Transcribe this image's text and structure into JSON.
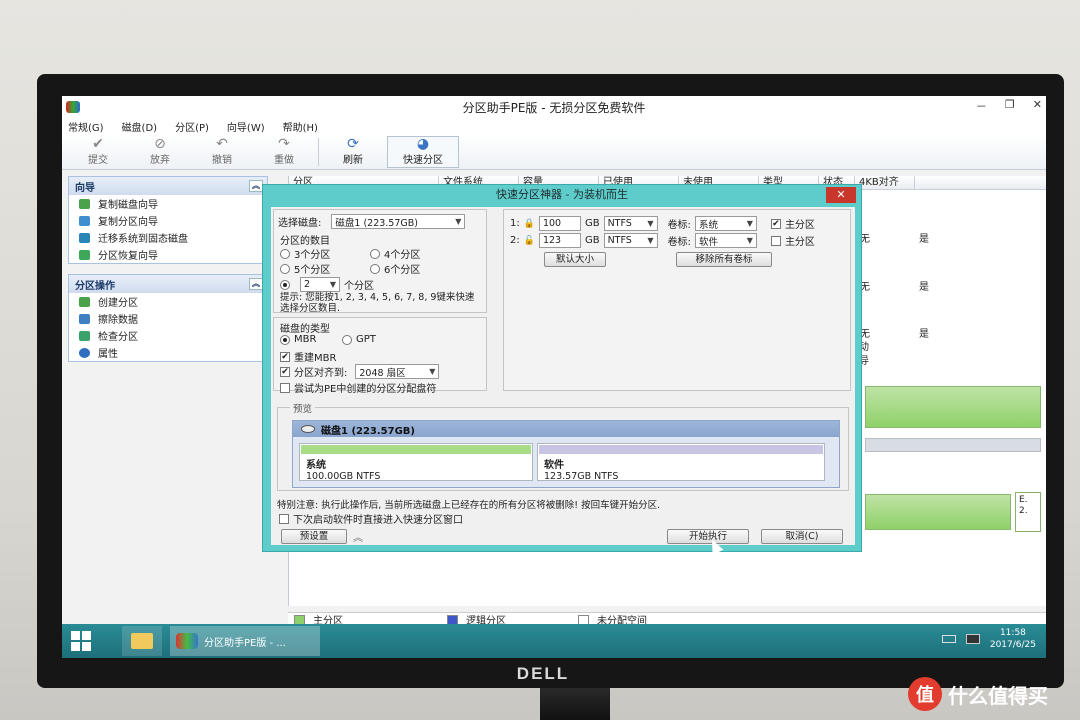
{
  "window": {
    "title": "分区助手PE版 - 无损分区免费软件",
    "controls": [
      "－",
      "❐",
      "✕"
    ]
  },
  "menu": [
    "常规(G)",
    "磁盘(D)",
    "分区(P)",
    "向导(W)",
    "帮助(H)"
  ],
  "toolbar": [
    {
      "label": "提交",
      "icon": "check-icon"
    },
    {
      "label": "放弃",
      "icon": "discard-icon"
    },
    {
      "label": "撤销",
      "icon": "undo-icon"
    },
    {
      "label": "重做",
      "icon": "redo-icon"
    },
    {
      "label": "刷新",
      "icon": "refresh-icon"
    },
    {
      "label": "快速分区",
      "icon": "quick-partition-icon"
    }
  ],
  "sidebar": {
    "wizard": {
      "title": "向导",
      "items": [
        "复制磁盘向导",
        "复制分区向导",
        "迁移系统到固态磁盘",
        "分区恢复向导"
      ]
    },
    "partition_ops": {
      "title": "分区操作",
      "items": [
        "创建分区",
        "擦除数据",
        "检查分区",
        "属性"
      ]
    }
  },
  "table": {
    "headers": [
      "分区",
      "文件系统",
      "容量",
      "已使用",
      "未使用",
      "类型",
      "状态",
      "4KB对齐"
    ],
    "visible_cells": [
      "无",
      "是",
      "无",
      "是",
      "无",
      "是",
      "活动",
      "引导"
    ]
  },
  "status_legend": [
    "主分区",
    "逻辑分区",
    "未分配空间"
  ],
  "disk_map_snippet": "E.\n2.",
  "taskbar": {
    "app_label": "分区助手PE版 - ...",
    "time": "11:58",
    "date": "2017/6/25"
  },
  "dialog": {
    "title": "快速分区神器 - 为装机而生",
    "select_disk_label": "选择磁盘:",
    "select_disk_value": "磁盘1 (223.57GB)",
    "partition_count_label": "分区的数目",
    "partition_options": [
      "3个分区",
      "4个分区",
      "5个分区",
      "6个分区"
    ],
    "partition_count_value": "2",
    "partition_count_suffix": "个分区",
    "hint": "提示: 您能按1, 2, 3, 4, 5, 6, 7, 8, 9键来快速选择分区数目.",
    "disk_type_label": "磁盘的类型",
    "disk_types": [
      "MBR",
      "GPT"
    ],
    "rebuild_mbr": "重建MBR",
    "align_label": "分区对齐到:",
    "align_value": "2048 扇区",
    "assign_letter": "尝试为PE中创建的分区分配盘符",
    "partitions": [
      {
        "index": "1:",
        "size": "100",
        "unit": "GB",
        "fs": "NTFS",
        "label_caption": "卷标:",
        "label": "系统",
        "primary": "主分区",
        "primary_checked": true
      },
      {
        "index": "2:",
        "size": "123",
        "unit": "GB",
        "fs": "NTFS",
        "label_caption": "卷标:",
        "label": "软件",
        "primary": "主分区",
        "primary_checked": false
      }
    ],
    "default_size_btn": "默认大小",
    "remove_labels_btn": "移除所有卷标",
    "preview_legend": "预览",
    "preview_disk": "磁盘1 (223.57GB)",
    "preview_parts": [
      {
        "name": "系统",
        "info": "100.00GB NTFS"
      },
      {
        "name": "软件",
        "info": "123.57GB NTFS"
      }
    ],
    "warning": "特别注意: 执行此操作后, 当前所选磁盘上已经存在的所有分区将被删除! 按回车键开始分区.",
    "next_boot": "下次启动软件时直接进入快速分区窗口",
    "preset_btn": "预设置",
    "start_btn": "开始执行",
    "cancel_btn": "取消(C)"
  },
  "brand": "DELL",
  "watermark": {
    "icon": "值",
    "text": "什么值得买"
  },
  "colors": {
    "dialog_frame": "#5fcccc",
    "primary_partition": "#8fd169",
    "logical_partition": "#3b57c9",
    "taskbar": "#1d7a85"
  }
}
